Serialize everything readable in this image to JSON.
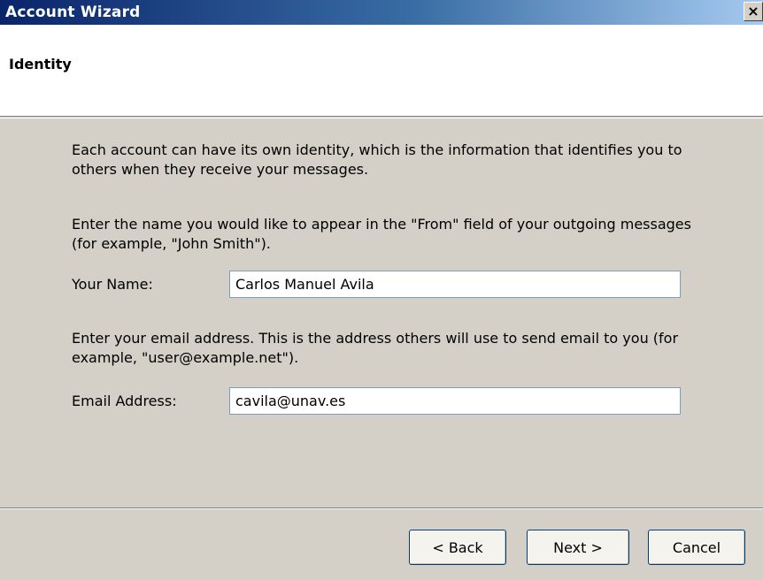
{
  "window": {
    "title": "Account Wizard",
    "close_glyph": "×"
  },
  "header": {
    "title": "Identity"
  },
  "content": {
    "intro": "Each account can have its own identity, which is the information that identifies you to others when they receive your messages.",
    "name_instruction": "Enter the name you would like to appear in the \"From\" field of your outgoing messages (for example, \"John Smith\").",
    "name_label": "Your Name:",
    "name_value": "Carlos Manuel Avila",
    "email_instruction": "Enter your email address. This is the address others will use to send email to you (for example, \"user@example.net\").",
    "email_label": "Email Address:",
    "email_value": "cavila@unav.es"
  },
  "buttons": {
    "back": "< Back",
    "next": "Next >",
    "cancel": "Cancel"
  }
}
